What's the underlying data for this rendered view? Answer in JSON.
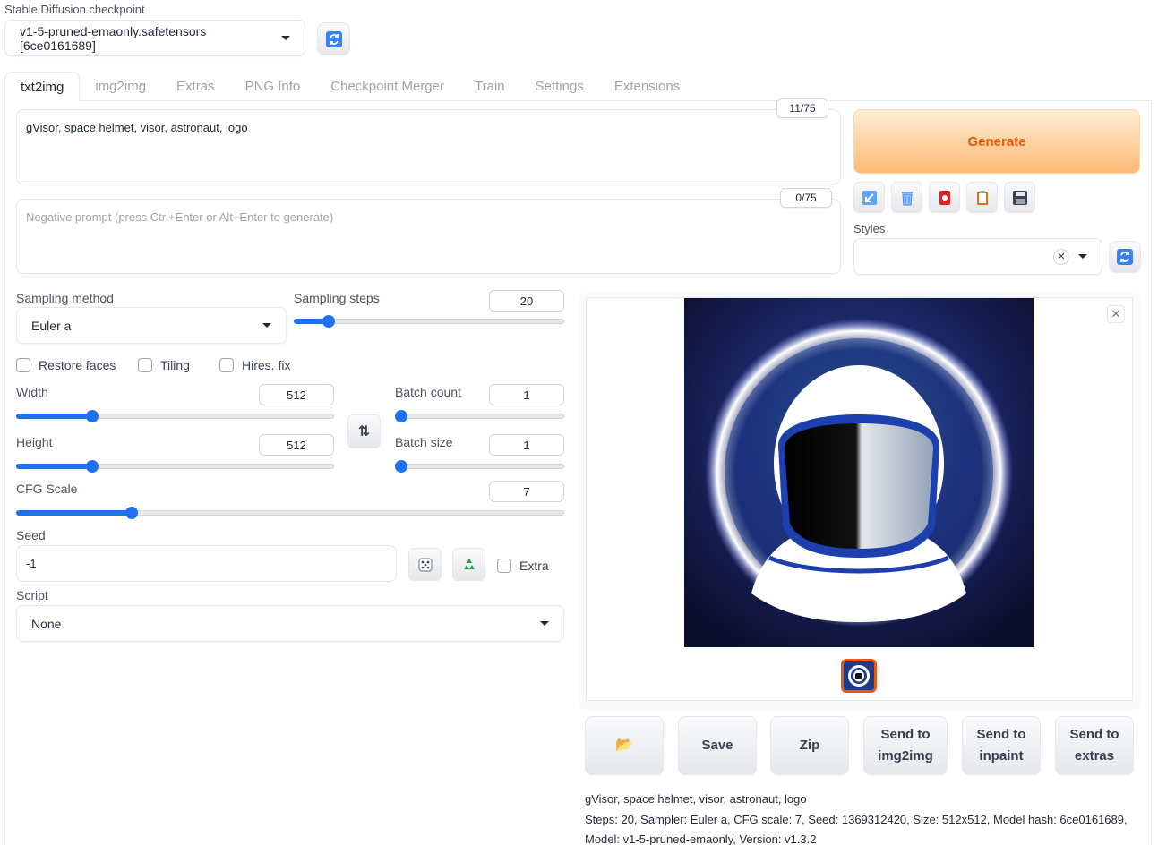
{
  "checkpoint": {
    "label": "Stable Diffusion checkpoint",
    "value": "v1-5-pruned-emaonly.safetensors [6ce0161689]",
    "refresh_icon": "refresh-icon"
  },
  "tabs": [
    {
      "label": "txt2img",
      "active": true
    },
    {
      "label": "img2img"
    },
    {
      "label": "Extras"
    },
    {
      "label": "PNG Info"
    },
    {
      "label": "Checkpoint Merger"
    },
    {
      "label": "Train"
    },
    {
      "label": "Settings"
    },
    {
      "label": "Extensions"
    }
  ],
  "prompt": {
    "value": "gVisor, space helmet, visor, astronaut, logo",
    "counter": "11/75"
  },
  "negative_prompt": {
    "placeholder": "Negative prompt (press Ctrl+Enter or Alt+Enter to generate)",
    "value": "",
    "counter": "0/75"
  },
  "generate": {
    "label": "Generate"
  },
  "tools": [
    "arrow-icon",
    "trash-icon",
    "red-card-icon",
    "clipboard-icon",
    "floppy-disk-icon"
  ],
  "styles": {
    "label": "Styles",
    "value": ""
  },
  "sampling": {
    "method_label": "Sampling method",
    "method_value": "Euler a",
    "steps_label": "Sampling steps",
    "steps_value": "20",
    "steps_fraction": 0.13
  },
  "checks": {
    "restore_faces": "Restore faces",
    "tiling": "Tiling",
    "hires_fix": "Hires. fix"
  },
  "width": {
    "label": "Width",
    "value": "512",
    "fraction": 0.24
  },
  "height": {
    "label": "Height",
    "value": "512",
    "fraction": 0.24
  },
  "batch_count": {
    "label": "Batch count",
    "value": "1",
    "fraction": 0.0
  },
  "batch_size": {
    "label": "Batch size",
    "value": "1",
    "fraction": 0.0
  },
  "cfg": {
    "label": "CFG Scale",
    "value": "7",
    "fraction": 0.21
  },
  "seed": {
    "label": "Seed",
    "value": "-1",
    "extra_label": "Extra"
  },
  "script": {
    "label": "Script",
    "value": "None"
  },
  "actions": {
    "folder_icon": "folder-icon",
    "save": "Save",
    "zip": "Zip",
    "send_img2img_1": "Send to",
    "send_img2img_2": "img2img",
    "send_inpaint_1": "Send to",
    "send_inpaint_2": "inpaint",
    "send_extras_1": "Send to",
    "send_extras_2": "extras"
  },
  "info": {
    "prompt": "gVisor, space helmet, visor, astronaut, logo",
    "params_1": "Steps: 20, Sampler: Euler a, CFG scale: 7, Seed: 1369312420, Size: 512x512, Model hash: 6ce0161689,",
    "params_2": "Model: v1-5-pruned-emaonly, Version: v1.3.2"
  }
}
